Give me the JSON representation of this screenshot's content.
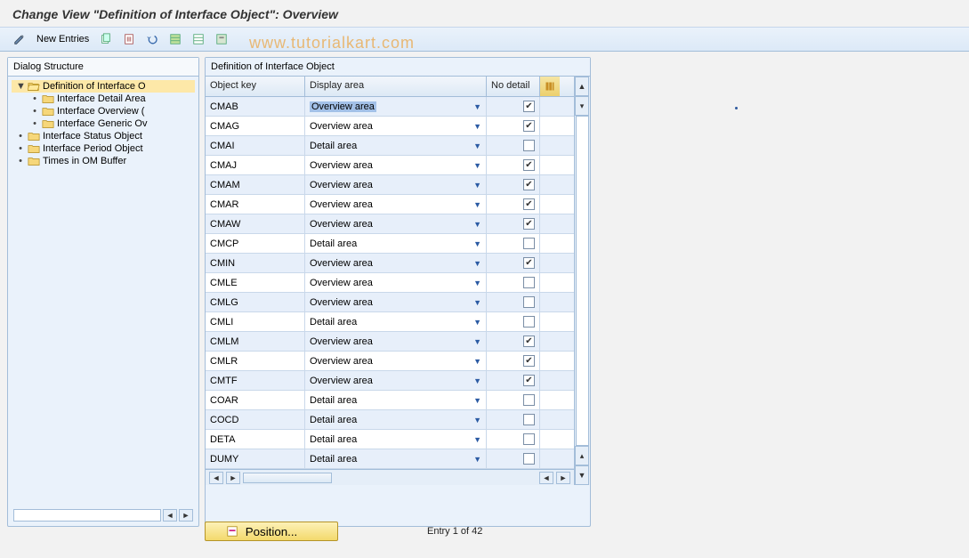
{
  "title": "Change View \"Definition of Interface Object\": Overview",
  "watermark": "www.tutorialkart.com",
  "toolbar": {
    "new_entries": "New Entries"
  },
  "dialog_structure": {
    "header": "Dialog Structure",
    "nodes": [
      {
        "level": 0,
        "caret": "▼",
        "open": true,
        "selected": true,
        "label": "Definition of Interface O"
      },
      {
        "level": 1,
        "caret": "•",
        "open": false,
        "selected": false,
        "label": "Interface Detail Area"
      },
      {
        "level": 1,
        "caret": "•",
        "open": false,
        "selected": false,
        "label": "Interface Overview ("
      },
      {
        "level": 1,
        "caret": "•",
        "open": false,
        "selected": false,
        "label": "Interface Generic Ov"
      },
      {
        "level": 0,
        "caret": "•",
        "open": false,
        "selected": false,
        "label": "Interface Status Object"
      },
      {
        "level": 0,
        "caret": "•",
        "open": false,
        "selected": false,
        "label": "Interface Period Object"
      },
      {
        "level": 0,
        "caret": "•",
        "open": false,
        "selected": false,
        "label": "Times in OM Buffer"
      }
    ]
  },
  "grid": {
    "title": "Definition of Interface Object",
    "columns": {
      "key": "Object key",
      "area": "Display area",
      "nodetail": "No detail"
    },
    "rows": [
      {
        "key": "CMAB",
        "area": "Overview area",
        "nd": true,
        "highlight": true
      },
      {
        "key": "CMAG",
        "area": "Overview area",
        "nd": true
      },
      {
        "key": "CMAI",
        "area": "Detail area",
        "nd": false
      },
      {
        "key": "CMAJ",
        "area": "Overview area",
        "nd": true
      },
      {
        "key": "CMAM",
        "area": "Overview area",
        "nd": true
      },
      {
        "key": "CMAR",
        "area": "Overview area",
        "nd": true
      },
      {
        "key": "CMAW",
        "area": "Overview area",
        "nd": true
      },
      {
        "key": "CMCP",
        "area": "Detail area",
        "nd": false
      },
      {
        "key": "CMIN",
        "area": "Overview area",
        "nd": true
      },
      {
        "key": "CMLE",
        "area": "Overview area",
        "nd": false
      },
      {
        "key": "CMLG",
        "area": "Overview area",
        "nd": false
      },
      {
        "key": "CMLI",
        "area": "Detail area",
        "nd": false
      },
      {
        "key": "CMLM",
        "area": "Overview area",
        "nd": true
      },
      {
        "key": "CMLR",
        "area": "Overview area",
        "nd": true
      },
      {
        "key": "CMTF",
        "area": "Overview area",
        "nd": true
      },
      {
        "key": "COAR",
        "area": "Detail area",
        "nd": false
      },
      {
        "key": "COCD",
        "area": "Detail area",
        "nd": false
      },
      {
        "key": "DETA",
        "area": "Detail area",
        "nd": false
      },
      {
        "key": "DUMY",
        "area": "Detail area",
        "nd": false
      }
    ]
  },
  "footer": {
    "position": "Position...",
    "entry": "Entry 1 of 42"
  }
}
